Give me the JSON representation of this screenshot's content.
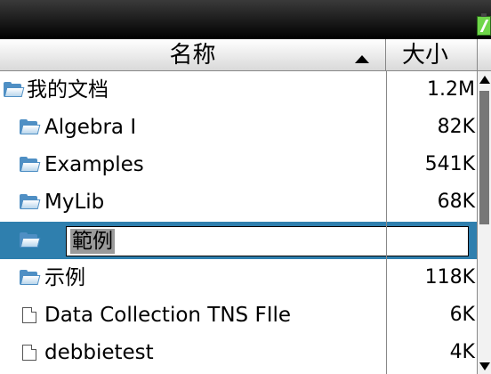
{
  "header": {
    "name_label": "名称",
    "size_label": "大小"
  },
  "files": [
    {
      "name": "我的文档",
      "size": "1.2M",
      "kind": "folder",
      "indent": 0
    },
    {
      "name": "Algebra I",
      "size": "82K",
      "kind": "folder",
      "indent": 1
    },
    {
      "name": "Examples",
      "size": "541K",
      "kind": "folder",
      "indent": 1
    },
    {
      "name": "MyLib",
      "size": "68K",
      "kind": "folder",
      "indent": 1
    },
    {
      "name": "範例",
      "size": "",
      "kind": "folder",
      "indent": 1,
      "selected": true,
      "renaming": true
    },
    {
      "name": "示例",
      "size": "118K",
      "kind": "folder",
      "indent": 1
    },
    {
      "name": "Data Collection TNS FIle",
      "size": "6K",
      "kind": "file",
      "indent": 1
    },
    {
      "name": "debbietest",
      "size": "4K",
      "kind": "file",
      "indent": 1
    }
  ],
  "rename": {
    "value": "範例"
  },
  "colors": {
    "selection": "#2f7fae",
    "folder": "#4f8fc4",
    "battery": "#6fd64a"
  }
}
